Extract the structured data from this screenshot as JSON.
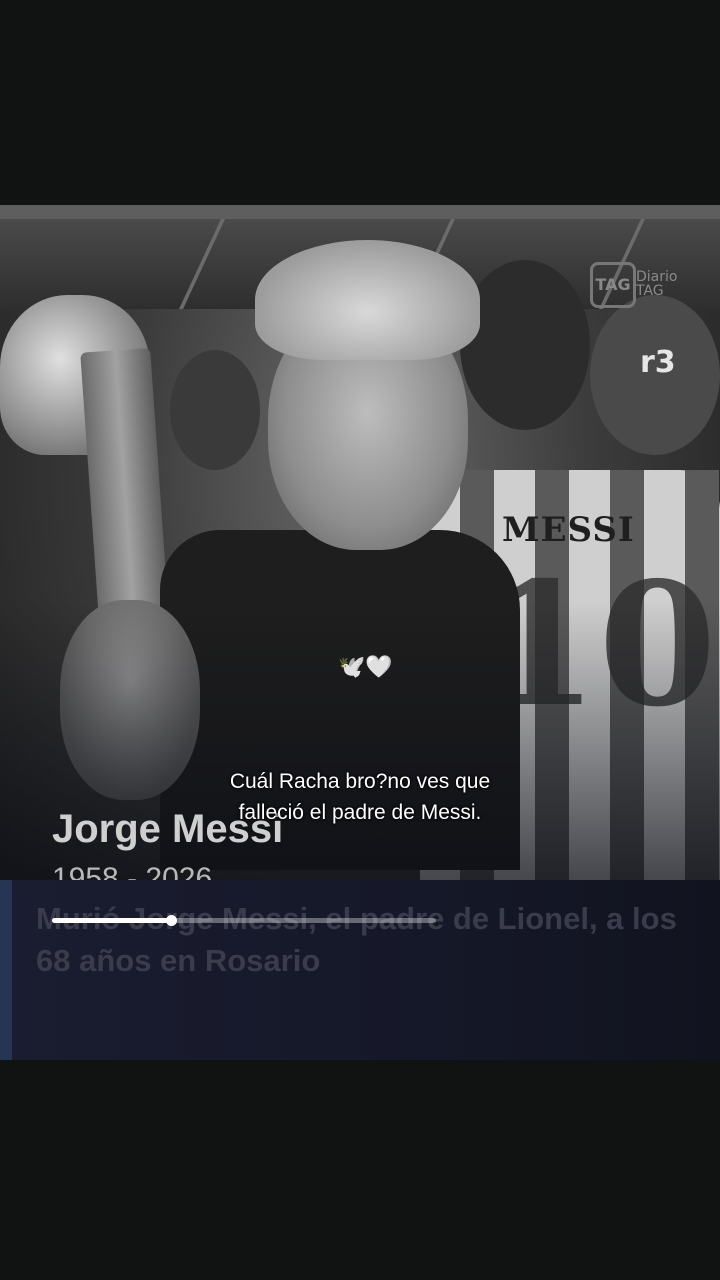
{
  "video": {
    "watermark_badge": "TAG",
    "watermark_text": "Diario TAG",
    "channel_tag": "r3",
    "emojis": "🕊️🤍",
    "caption": "Cuál Racha bro?no ves que falleció el padre de Messi.",
    "jersey_name": "MESSI",
    "jersey_number": "10"
  },
  "overlay": {
    "name": "Jorge Messi",
    "years": "1958 - 2026",
    "headline": "Murió Jorge Messi, el padre de Lionel, a los 68 años en Rosario"
  },
  "playback": {
    "progress": 0.31
  }
}
